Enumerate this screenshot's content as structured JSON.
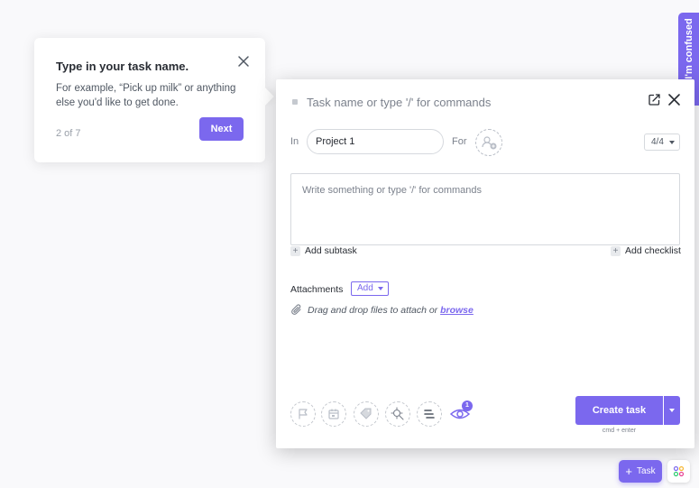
{
  "tooltip": {
    "title": "Type in your task name.",
    "body": "For example, “Pick up milk” or anything else you'd like to get done.",
    "step": "2 of 7",
    "next_label": "Next"
  },
  "side_tab": {
    "label": "I'm confused"
  },
  "task_form": {
    "name_placeholder": "Task name or type '/' for commands",
    "in_label": "In",
    "project": "Project 1",
    "for_label": "For",
    "status": "4/4",
    "description_placeholder": "Write something or type '/' for commands",
    "add_subtask": "Add subtask",
    "add_checklist": "Add checklist",
    "attachments_label": "Attachments",
    "attachments_add": "Add",
    "drag_text": "Drag and drop files to attach or",
    "browse_text": "browse",
    "watchers_count": "1",
    "create_label": "Create task",
    "shortcut_hint": "cmd + enter"
  },
  "bottom_bar": {
    "task_label": "Task"
  },
  "colors": {
    "accent": "#7b68ee",
    "text": "#292d34",
    "muted": "#7c828d"
  }
}
